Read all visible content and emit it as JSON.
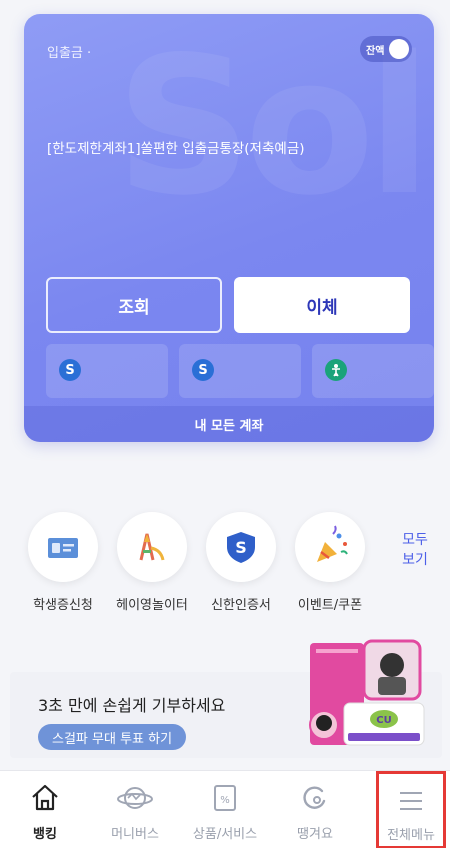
{
  "account": {
    "label": "입출금 ·",
    "balance_toggle": "잔액",
    "name": "[한도제한계좌1]쏠편한 입출금통장(저축예금)",
    "watermark": "Sol",
    "inquiry_button": "조회",
    "transfer_button": "이체",
    "all_accounts": "내 모든 계좌",
    "tile_icons": [
      "shinhan-bank-icon",
      "shinhan-bank-icon",
      "shinhan-life-icon"
    ]
  },
  "quick_menu": {
    "items": [
      {
        "label": "학생증신청",
        "icon": "student-id-icon"
      },
      {
        "label": "헤이영놀이터",
        "icon": "playground-icon"
      },
      {
        "label": "신한인증서",
        "icon": "certificate-shield-icon"
      },
      {
        "label": "이벤트/쿠폰",
        "icon": "party-popper-icon"
      }
    ],
    "more_line1": "모두",
    "more_line2": "보기"
  },
  "banner": {
    "title": "3초 만에 손쉽게 기부하세요",
    "button": "스걸파 무대 투표 하기"
  },
  "tabbar": {
    "items": [
      {
        "label": "뱅킹",
        "icon": "home-icon",
        "active": true
      },
      {
        "label": "머니버스",
        "icon": "planet-icon",
        "active": false
      },
      {
        "label": "상품/서비스",
        "icon": "product-icon",
        "active": false
      },
      {
        "label": "땡겨요",
        "icon": "ddangyo-icon",
        "active": false
      },
      {
        "label": "전체메뉴",
        "icon": "menu-icon",
        "active": false
      }
    ]
  },
  "colors": {
    "card": "#7b87f0",
    "accent": "#4c5fe8",
    "highlight": "#e53935"
  }
}
